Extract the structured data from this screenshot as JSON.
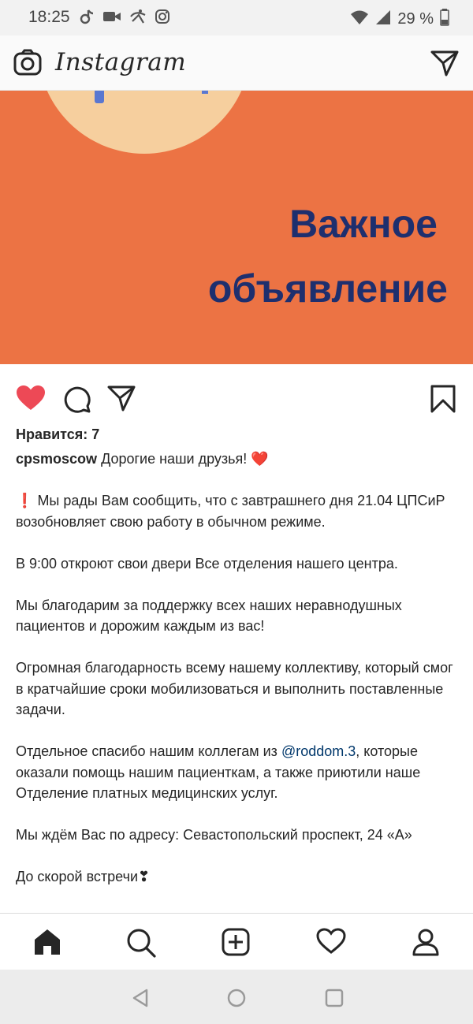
{
  "status_bar": {
    "time": "18:25",
    "battery": "29 %",
    "icons": [
      "tiktok-icon",
      "video-icon",
      "app-icon",
      "instagram-small-icon",
      "wifi-icon",
      "signal-icon",
      "battery-icon"
    ]
  },
  "header": {
    "logo_text": "Instagram",
    "icons": [
      "camera-icon",
      "direct-message-icon"
    ]
  },
  "post": {
    "image_headline_line1": "Важное",
    "image_headline_line2": "объявление",
    "colors": {
      "background": "#ec7344",
      "circle": "#f6cf9e",
      "headline": "#1e2f6e"
    },
    "likes": "Нравится: 7",
    "username": "cpsmoscow",
    "caption_first": "Дорогие наши друзья!",
    "heart_emoji": "❤️",
    "excl_emoji": "❗",
    "para1": "Мы рады Вам сообщить, что с завтрашнего дня 21.04 ЦПСиР возобновляет свою работу в обычном режиме.",
    "para2": "В 9:00 откроют свои двери Все отделения нашего центра.",
    "para3": "Мы благодарим за поддержку всех наших неравнодушных пациентов и дорожим каждым из вас!",
    "para4": "Огромная благодарность всему нашему коллективу, который смог в кратчайшие сроки мобилизоваться и выполнить поставленные задачи.",
    "para5_before": " Отдельное спасибо нашим коллегам из ",
    "para5_mention": "@roddom.3",
    "para5_after": ", которые оказали помощь нашим пациенткам, а также приютили наше Отделение платных медицинских услуг.",
    "para6": "Мы ждём Вас по адресу: Севастопольский проспект, 24 «А»",
    "para7": "До скорой встречи",
    "para7_emoji": "❣"
  },
  "actions": {
    "icons": [
      "heart-filled-icon",
      "comment-icon",
      "share-icon",
      "bookmark-icon"
    ],
    "like_color": "#ed4956"
  },
  "bottom_nav": {
    "icons": [
      "home-icon",
      "search-icon",
      "add-post-icon",
      "activity-heart-icon",
      "profile-icon"
    ]
  },
  "system_nav": {
    "icons": [
      "back-icon",
      "home-circle-icon",
      "recents-icon"
    ]
  }
}
